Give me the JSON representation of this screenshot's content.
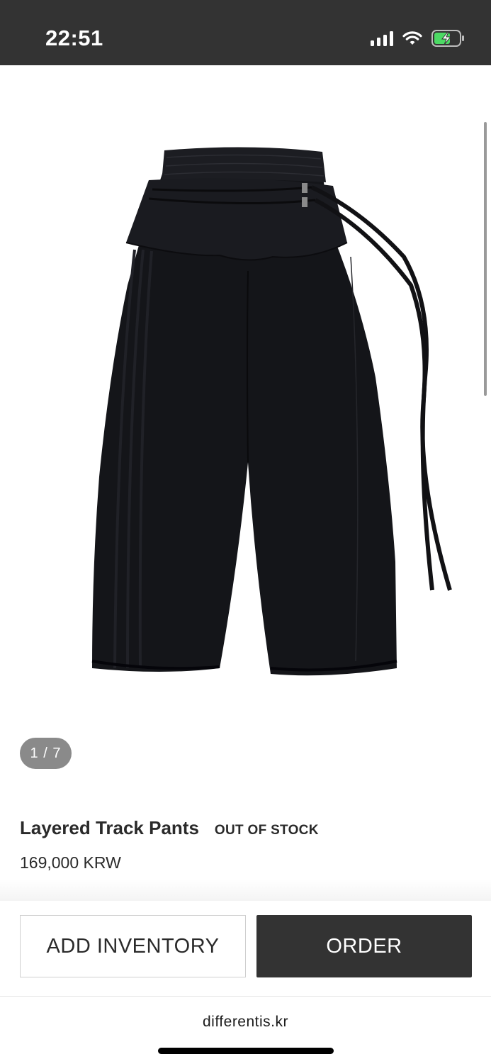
{
  "status_bar": {
    "time": "22:51",
    "icons": [
      "signal-icon",
      "wifi-icon",
      "battery-charging-icon"
    ],
    "battery_color": "#4cd964"
  },
  "gallery": {
    "counter": "1 / 7",
    "image_subject": "black layered track pants"
  },
  "product": {
    "title": "Layered Track Pants",
    "stock_status": "OUT OF STOCK",
    "price": "169,000 KRW"
  },
  "actions": {
    "add_inventory_label": "ADD INVENTORY",
    "order_label": "ORDER"
  },
  "browser": {
    "url": "differentis.kr"
  },
  "colors": {
    "status_bar_bg": "#333333",
    "order_button_bg": "#333333",
    "counter_pill_bg": "#8a8a8a"
  }
}
